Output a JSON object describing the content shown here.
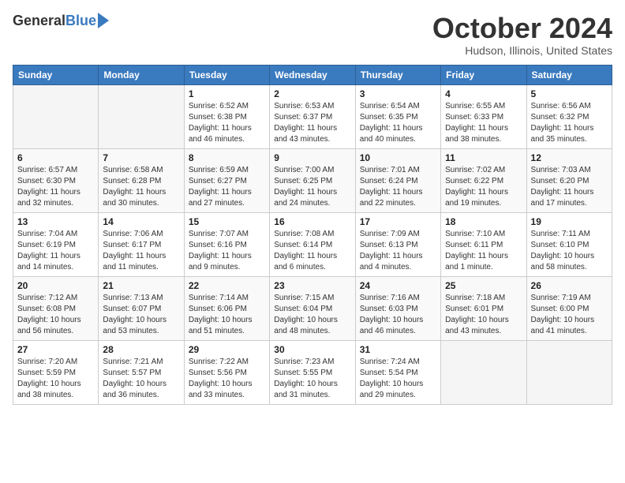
{
  "header": {
    "logo_general": "General",
    "logo_blue": "Blue",
    "month": "October 2024",
    "location": "Hudson, Illinois, United States"
  },
  "days_of_week": [
    "Sunday",
    "Monday",
    "Tuesday",
    "Wednesday",
    "Thursday",
    "Friday",
    "Saturday"
  ],
  "weeks": [
    [
      {
        "day": "",
        "empty": true
      },
      {
        "day": "",
        "empty": true
      },
      {
        "day": "1",
        "sunrise": "6:52 AM",
        "sunset": "6:38 PM",
        "daylight": "11 hours and 46 minutes."
      },
      {
        "day": "2",
        "sunrise": "6:53 AM",
        "sunset": "6:37 PM",
        "daylight": "11 hours and 43 minutes."
      },
      {
        "day": "3",
        "sunrise": "6:54 AM",
        "sunset": "6:35 PM",
        "daylight": "11 hours and 40 minutes."
      },
      {
        "day": "4",
        "sunrise": "6:55 AM",
        "sunset": "6:33 PM",
        "daylight": "11 hours and 38 minutes."
      },
      {
        "day": "5",
        "sunrise": "6:56 AM",
        "sunset": "6:32 PM",
        "daylight": "11 hours and 35 minutes."
      }
    ],
    [
      {
        "day": "6",
        "sunrise": "6:57 AM",
        "sunset": "6:30 PM",
        "daylight": "11 hours and 32 minutes."
      },
      {
        "day": "7",
        "sunrise": "6:58 AM",
        "sunset": "6:28 PM",
        "daylight": "11 hours and 30 minutes."
      },
      {
        "day": "8",
        "sunrise": "6:59 AM",
        "sunset": "6:27 PM",
        "daylight": "11 hours and 27 minutes."
      },
      {
        "day": "9",
        "sunrise": "7:00 AM",
        "sunset": "6:25 PM",
        "daylight": "11 hours and 24 minutes."
      },
      {
        "day": "10",
        "sunrise": "7:01 AM",
        "sunset": "6:24 PM",
        "daylight": "11 hours and 22 minutes."
      },
      {
        "day": "11",
        "sunrise": "7:02 AM",
        "sunset": "6:22 PM",
        "daylight": "11 hours and 19 minutes."
      },
      {
        "day": "12",
        "sunrise": "7:03 AM",
        "sunset": "6:20 PM",
        "daylight": "11 hours and 17 minutes."
      }
    ],
    [
      {
        "day": "13",
        "sunrise": "7:04 AM",
        "sunset": "6:19 PM",
        "daylight": "11 hours and 14 minutes."
      },
      {
        "day": "14",
        "sunrise": "7:06 AM",
        "sunset": "6:17 PM",
        "daylight": "11 hours and 11 minutes."
      },
      {
        "day": "15",
        "sunrise": "7:07 AM",
        "sunset": "6:16 PM",
        "daylight": "11 hours and 9 minutes."
      },
      {
        "day": "16",
        "sunrise": "7:08 AM",
        "sunset": "6:14 PM",
        "daylight": "11 hours and 6 minutes."
      },
      {
        "day": "17",
        "sunrise": "7:09 AM",
        "sunset": "6:13 PM",
        "daylight": "11 hours and 4 minutes."
      },
      {
        "day": "18",
        "sunrise": "7:10 AM",
        "sunset": "6:11 PM",
        "daylight": "11 hours and 1 minute."
      },
      {
        "day": "19",
        "sunrise": "7:11 AM",
        "sunset": "6:10 PM",
        "daylight": "10 hours and 58 minutes."
      }
    ],
    [
      {
        "day": "20",
        "sunrise": "7:12 AM",
        "sunset": "6:08 PM",
        "daylight": "10 hours and 56 minutes."
      },
      {
        "day": "21",
        "sunrise": "7:13 AM",
        "sunset": "6:07 PM",
        "daylight": "10 hours and 53 minutes."
      },
      {
        "day": "22",
        "sunrise": "7:14 AM",
        "sunset": "6:06 PM",
        "daylight": "10 hours and 51 minutes."
      },
      {
        "day": "23",
        "sunrise": "7:15 AM",
        "sunset": "6:04 PM",
        "daylight": "10 hours and 48 minutes."
      },
      {
        "day": "24",
        "sunrise": "7:16 AM",
        "sunset": "6:03 PM",
        "daylight": "10 hours and 46 minutes."
      },
      {
        "day": "25",
        "sunrise": "7:18 AM",
        "sunset": "6:01 PM",
        "daylight": "10 hours and 43 minutes."
      },
      {
        "day": "26",
        "sunrise": "7:19 AM",
        "sunset": "6:00 PM",
        "daylight": "10 hours and 41 minutes."
      }
    ],
    [
      {
        "day": "27",
        "sunrise": "7:20 AM",
        "sunset": "5:59 PM",
        "daylight": "10 hours and 38 minutes."
      },
      {
        "day": "28",
        "sunrise": "7:21 AM",
        "sunset": "5:57 PM",
        "daylight": "10 hours and 36 minutes."
      },
      {
        "day": "29",
        "sunrise": "7:22 AM",
        "sunset": "5:56 PM",
        "daylight": "10 hours and 33 minutes."
      },
      {
        "day": "30",
        "sunrise": "7:23 AM",
        "sunset": "5:55 PM",
        "daylight": "10 hours and 31 minutes."
      },
      {
        "day": "31",
        "sunrise": "7:24 AM",
        "sunset": "5:54 PM",
        "daylight": "10 hours and 29 minutes."
      },
      {
        "day": "",
        "empty": true
      },
      {
        "day": "",
        "empty": true
      }
    ]
  ],
  "labels": {
    "sunrise": "Sunrise:",
    "sunset": "Sunset:",
    "daylight": "Daylight:"
  }
}
